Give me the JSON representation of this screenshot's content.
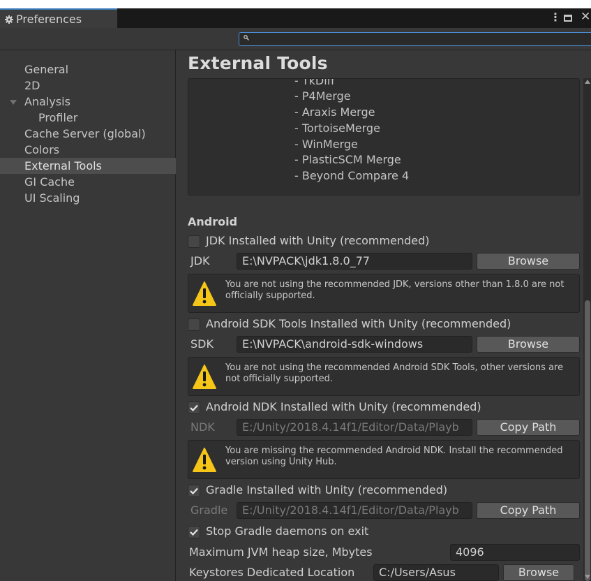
{
  "window": {
    "tab_title": "Preferences",
    "search": {
      "value": "",
      "placeholder": ""
    }
  },
  "sidebar": {
    "items": [
      {
        "label": "General"
      },
      {
        "label": "2D"
      },
      {
        "label": "Analysis"
      },
      {
        "label": "Profiler"
      },
      {
        "label": "Cache Server (global)"
      },
      {
        "label": "Colors"
      },
      {
        "label": "External Tools"
      },
      {
        "label": "GI Cache"
      },
      {
        "label": "UI Scaling"
      }
    ],
    "selected": "External Tools"
  },
  "main": {
    "title": "External Tools",
    "diff_tools": [
      "- TkDiff",
      "- P4Merge",
      "- Araxis Merge",
      "- TortoiseMerge",
      "- WinMerge",
      "- PlasticSCM Merge",
      "- Beyond Compare 4"
    ],
    "android": {
      "header": "Android",
      "jdk": {
        "checkbox_label": "JDK Installed with Unity (recommended)",
        "checked": false,
        "label": "JDK",
        "path": "E:\\NVPACK\\jdk1.8.0_77",
        "button": "Browse",
        "warning": "You are not using the recommended JDK, versions other than 1.8.0 are not officially supported."
      },
      "sdk": {
        "checkbox_label": "Android SDK Tools Installed with Unity (recommended)",
        "checked": false,
        "label": "SDK",
        "path": "E:\\NVPACK\\android-sdk-windows",
        "button": "Browse",
        "warning": "You are not using the recommended Android SDK Tools, other versions are not officially supported."
      },
      "ndk": {
        "checkbox_label": "Android NDK Installed with Unity (recommended)",
        "checked": true,
        "label": "NDK",
        "path": "E:/Unity/2018.4.14f1/Editor/Data/Playb",
        "button": "Copy Path",
        "warning": "You are missing the recommended Android NDK. Install the recommended version using Unity Hub."
      },
      "gradle": {
        "checkbox_label": "Gradle Installed with Unity (recommended)",
        "checked": true,
        "label": "Gradle",
        "path": "E:/Unity/2018.4.14f1/Editor/Data/Playb",
        "button": "Copy Path"
      },
      "stop_gradle": {
        "checkbox_label": "Stop Gradle daemons on exit",
        "checked": true
      },
      "jvm_heap": {
        "label": "Maximum JVM heap size, Mbytes",
        "value": "4096"
      },
      "keystore": {
        "label": "Keystores Dedicated Location",
        "value": "C:/Users/Asus",
        "button": "Browse"
      }
    }
  },
  "colors": {
    "accent": "#3a79bb",
    "window_bg": "#383838",
    "selected_bg": "#4d4d4d",
    "warning_yellow": "#f5c518"
  }
}
